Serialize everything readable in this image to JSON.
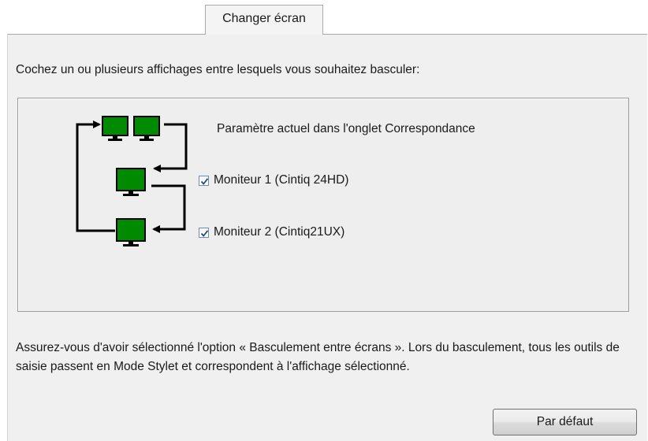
{
  "tab": {
    "label": "Changer écran"
  },
  "instruction": "Cochez un ou plusieurs affichages entre lesquels vous souhaitez basculer:",
  "current_setting": "Paramètre actuel dans l'onglet Correspondance",
  "monitors": [
    {
      "label": "Moniteur 1 (Cintiq 24HD)",
      "checked": true
    },
    {
      "label": "Moniteur 2 (Cintiq21UX)",
      "checked": true
    }
  ],
  "note": "Assurez-vous d'avoir sélectionné l'option « Basculement entre écrans ». Lors du basculement, tous les outils de saisie passent en Mode Stylet et correspondent à l'affichage sélectionné.",
  "buttons": {
    "default_label": "Par défaut"
  },
  "colors": {
    "monitor_green": "#008a00",
    "panel_bg": "#f0f0f0"
  },
  "icons": {
    "monitor": "monitor-icon",
    "checkmark": "checkmark-icon",
    "arrow": "arrow-icon"
  }
}
